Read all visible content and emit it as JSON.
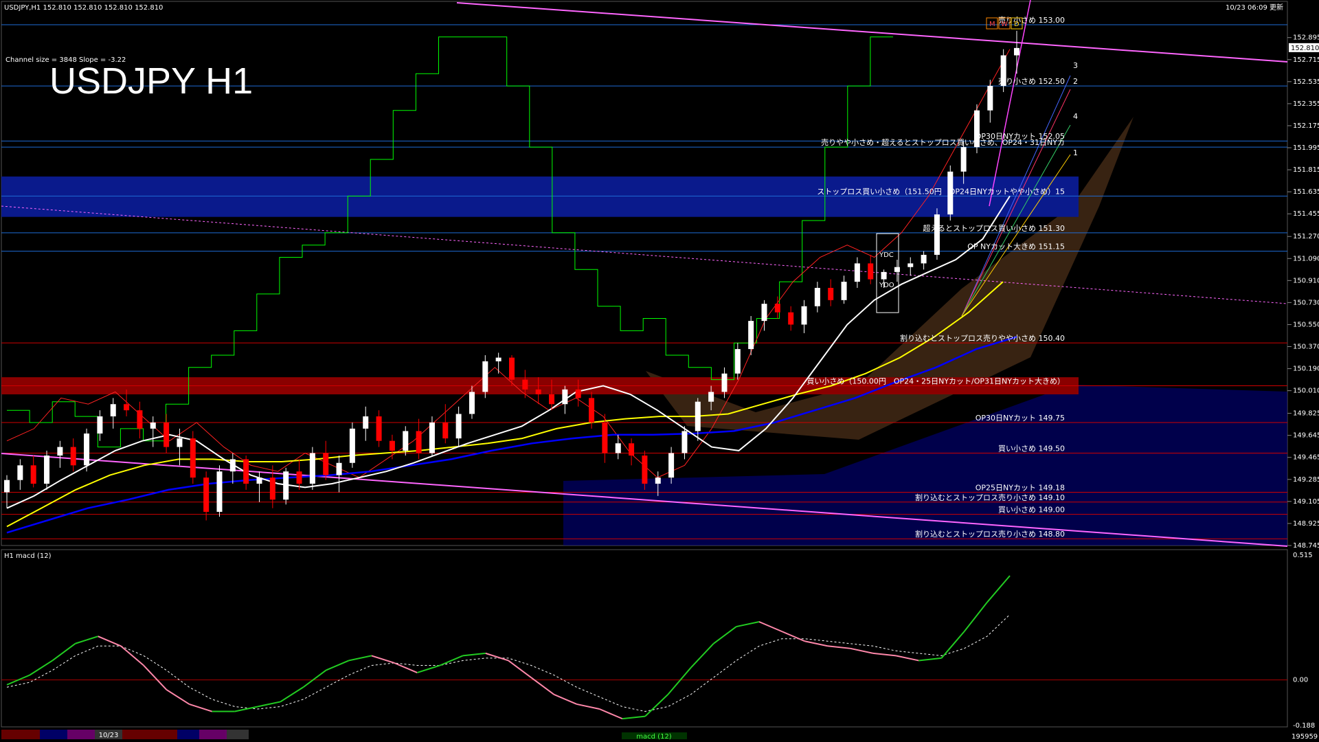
{
  "window": {
    "symbol_info": "USDJPY,H1  152.810 152.810 152.810 152.810",
    "timestamp": "10/23 06:09 更新",
    "title": "USDJPY H1",
    "channel_info": "Channel size = 3848 Slope = -3.22"
  },
  "colors": {
    "background": "#000000",
    "bull": "#ffffff",
    "bear": "#ff0000",
    "sma_white": "#ffffff",
    "sma_yellow": "#ffff00",
    "sma_blue": "#0000ff",
    "ichimoku_span": "#00ff00",
    "channel": "#ff66ff",
    "level_line": "#1e6bd6",
    "red_level": "#d00000",
    "macd_main": "#22cc22",
    "macd_down": "#ff88aa",
    "macd_signal": "#ffffff"
  },
  "chart_data": {
    "type": "candlestick",
    "symbol": "USDJPY",
    "timeframe": "H1",
    "ylim": [
      148.745,
      153.0
    ],
    "y_ticks": [
      "152.895",
      "152.715",
      "152.535",
      "152.355",
      "152.175",
      "151.995",
      "151.815",
      "151.635",
      "151.455",
      "151.270",
      "151.090",
      "150.910",
      "150.730",
      "150.550",
      "150.370",
      "150.190",
      "150.010",
      "149.825",
      "149.645",
      "149.465",
      "149.285",
      "149.105",
      "148.925",
      "148.745"
    ],
    "current_price": "152.810",
    "candles_ohlc": [
      [
        149.18,
        149.32,
        149.05,
        149.28
      ],
      [
        149.28,
        149.45,
        149.2,
        149.4
      ],
      [
        149.4,
        149.48,
        149.22,
        149.25
      ],
      [
        149.25,
        149.52,
        149.2,
        149.48
      ],
      [
        149.48,
        149.6,
        149.38,
        149.55
      ],
      [
        149.55,
        149.62,
        149.35,
        149.4
      ],
      [
        149.4,
        149.7,
        149.35,
        149.66
      ],
      [
        149.66,
        149.85,
        149.6,
        149.8
      ],
      [
        149.8,
        149.95,
        149.7,
        149.9
      ],
      [
        149.9,
        150.02,
        149.8,
        149.85
      ],
      [
        149.85,
        149.92,
        149.62,
        149.7
      ],
      [
        149.7,
        149.8,
        149.55,
        149.75
      ],
      [
        149.75,
        149.82,
        149.5,
        149.55
      ],
      [
        149.55,
        149.7,
        149.4,
        149.62
      ],
      [
        149.62,
        149.68,
        149.25,
        149.3
      ],
      [
        149.3,
        149.35,
        148.95,
        149.02
      ],
      [
        149.02,
        149.4,
        148.98,
        149.35
      ],
      [
        149.35,
        149.5,
        149.25,
        149.45
      ],
      [
        149.45,
        149.48,
        149.2,
        149.25
      ],
      [
        149.25,
        149.35,
        149.1,
        149.3
      ],
      [
        149.3,
        149.4,
        149.05,
        149.12
      ],
      [
        149.12,
        149.38,
        149.08,
        149.35
      ],
      [
        149.35,
        149.45,
        149.2,
        149.25
      ],
      [
        149.25,
        149.55,
        149.2,
        149.5
      ],
      [
        149.5,
        149.6,
        149.28,
        149.32
      ],
      [
        149.32,
        149.48,
        149.18,
        149.42
      ],
      [
        149.42,
        149.75,
        149.38,
        149.7
      ],
      [
        149.7,
        149.88,
        149.6,
        149.8
      ],
      [
        149.8,
        149.85,
        149.55,
        149.6
      ],
      [
        149.6,
        149.65,
        149.45,
        149.52
      ],
      [
        149.52,
        149.72,
        149.48,
        149.68
      ],
      [
        149.68,
        149.78,
        149.45,
        149.5
      ],
      [
        149.5,
        149.8,
        149.48,
        149.75
      ],
      [
        149.75,
        149.9,
        149.58,
        149.62
      ],
      [
        149.62,
        149.88,
        149.55,
        149.82
      ],
      [
        149.82,
        150.05,
        149.78,
        150.0
      ],
      [
        150.0,
        150.3,
        149.95,
        150.25
      ],
      [
        150.25,
        150.32,
        150.15,
        150.28
      ],
      [
        150.28,
        150.3,
        150.05,
        150.1
      ],
      [
        150.1,
        150.18,
        149.95,
        150.02
      ],
      [
        150.02,
        150.12,
        149.9,
        149.98
      ],
      [
        149.98,
        150.1,
        149.85,
        149.9
      ],
      [
        149.9,
        150.05,
        149.82,
        150.02
      ],
      [
        150.02,
        150.1,
        149.88,
        149.95
      ],
      [
        149.95,
        150.0,
        149.7,
        149.75
      ],
      [
        149.75,
        149.82,
        149.42,
        149.5
      ],
      [
        149.5,
        149.65,
        149.45,
        149.58
      ],
      [
        149.58,
        149.62,
        149.4,
        149.48
      ],
      [
        149.48,
        149.52,
        149.2,
        149.25
      ],
      [
        149.25,
        149.35,
        149.15,
        149.3
      ],
      [
        149.3,
        149.55,
        149.25,
        149.5
      ],
      [
        149.5,
        149.72,
        149.45,
        149.68
      ],
      [
        149.68,
        149.95,
        149.6,
        149.92
      ],
      [
        149.92,
        150.05,
        149.85,
        150.0
      ],
      [
        150.0,
        150.2,
        149.95,
        150.15
      ],
      [
        150.15,
        150.4,
        150.1,
        150.35
      ],
      [
        150.35,
        150.62,
        150.3,
        150.58
      ],
      [
        150.58,
        150.75,
        150.5,
        150.72
      ],
      [
        150.72,
        150.78,
        150.6,
        150.65
      ],
      [
        150.65,
        150.7,
        150.5,
        150.55
      ],
      [
        150.55,
        150.75,
        150.48,
        150.7
      ],
      [
        150.7,
        150.9,
        150.65,
        150.85
      ],
      [
        150.85,
        150.92,
        150.7,
        150.75
      ],
      [
        150.75,
        150.95,
        150.72,
        150.9
      ],
      [
        150.9,
        151.1,
        150.85,
        151.05
      ],
      [
        151.05,
        151.12,
        150.88,
        150.92
      ],
      [
        150.92,
        151.0,
        150.85,
        150.98
      ],
      [
        150.98,
        151.08,
        150.9,
        151.02
      ],
      [
        151.02,
        151.1,
        150.95,
        151.05
      ],
      [
        151.05,
        151.15,
        151.0,
        151.12
      ],
      [
        151.12,
        151.5,
        151.08,
        151.45
      ],
      [
        151.45,
        151.85,
        151.4,
        151.8
      ],
      [
        151.8,
        152.05,
        151.7,
        152.0
      ],
      [
        152.0,
        152.35,
        151.95,
        152.3
      ],
      [
        152.3,
        152.55,
        152.2,
        152.5
      ],
      [
        152.5,
        152.8,
        152.45,
        152.75
      ],
      [
        152.75,
        152.95,
        152.6,
        152.81
      ]
    ],
    "sma_white": [
      149.05,
      149.15,
      149.28,
      149.4,
      149.52,
      149.6,
      149.65,
      149.6,
      149.45,
      149.32,
      149.25,
      149.22,
      149.25,
      149.3,
      149.35,
      149.42,
      149.5,
      149.58,
      149.65,
      149.72,
      149.85,
      150.0,
      150.05,
      149.98,
      149.85,
      149.7,
      149.55,
      149.52,
      149.7,
      149.95,
      150.25,
      150.55,
      150.75,
      150.88,
      150.98,
      151.08,
      151.25,
      151.6
    ],
    "sma_yellow": [
      148.9,
      149.05,
      149.2,
      149.32,
      149.4,
      149.45,
      149.45,
      149.43,
      149.43,
      149.45,
      149.48,
      149.5,
      149.52,
      149.55,
      149.58,
      149.62,
      149.7,
      149.75,
      149.78,
      149.8,
      149.8,
      149.82,
      149.9,
      149.98,
      150.05,
      150.15,
      150.28,
      150.45,
      150.65,
      150.9
    ],
    "sma_blue": [
      148.85,
      148.95,
      149.05,
      149.12,
      149.2,
      149.25,
      149.28,
      149.3,
      149.32,
      149.35,
      149.4,
      149.45,
      149.52,
      149.58,
      149.62,
      149.65,
      149.65,
      149.66,
      149.68,
      149.75,
      149.85,
      149.95,
      150.08,
      150.2,
      150.35,
      150.45
    ],
    "ichimoku_chikou": [
      149.6,
      149.7,
      149.95,
      149.9,
      150.0,
      149.8,
      149.6,
      149.75,
      149.55,
      149.4,
      149.35,
      149.5,
      149.4,
      149.3,
      149.45,
      149.6,
      149.8,
      150.0,
      150.2,
      150.0,
      149.85,
      149.95,
      149.8,
      149.5,
      149.3,
      149.4,
      149.7,
      150.1,
      150.6,
      150.9,
      151.1,
      151.2,
      151.1,
      151.3,
      151.6,
      152.0,
      152.4,
      152.8
    ],
    "ichimoku_green_line": [
      149.85,
      149.75,
      149.92,
      149.8,
      149.55,
      149.7,
      149.6,
      149.9,
      150.2,
      150.3,
      150.5,
      150.8,
      151.1,
      151.2,
      151.3,
      151.6,
      151.9,
      152.3,
      152.6,
      152.9,
      152.9,
      152.9,
      152.5,
      152.0,
      151.3,
      151.0,
      150.7,
      150.5,
      150.6,
      150.3,
      150.2,
      150.1,
      150.4,
      150.6,
      150.9,
      151.4,
      152.0,
      152.5,
      152.9,
      152.9
    ],
    "level_labels": [
      {
        "text": "売り小さめ 153.00",
        "price": 153.0
      },
      {
        "text": "売り小さめ 152.50",
        "price": 152.5
      },
      {
        "text": "OP30日NYカット 152.05",
        "price": 152.05
      },
      {
        "text": "売りやや小さめ・超えるとストップロス買い小さめ、OP24・31日NYカ",
        "price": 152.0
      },
      {
        "text": "ストップロス買い小さめ（151.50円　OP24日NYカットやや小さめ）15",
        "price": 151.6
      },
      {
        "text": "超えるとストップロス買い小さめ 151.30",
        "price": 151.3
      },
      {
        "text": "OP NYカット大きめ 151.15",
        "price": 151.15
      },
      {
        "text": "割り込むとストップロス売りやや小さめ 150.40",
        "price": 150.4
      },
      {
        "text": "買い小さめ（150.00円　OP24・25日NYカット/OP31日NYカット大きめ）",
        "price": 150.05
      },
      {
        "text": "OP30日NYカット 149.75",
        "price": 149.75
      },
      {
        "text": "買い小さめ 149.50",
        "price": 149.5
      },
      {
        "text": "OP25日NYカット 149.18",
        "price": 149.18
      },
      {
        "text": "割り込むとストップロス売り小さめ 149.10",
        "price": 149.1
      },
      {
        "text": "買い小さめ 149.00",
        "price": 149.0
      },
      {
        "text": "割り込むとストップロス売り小さめ 148.80",
        "price": 148.8
      }
    ],
    "fan_labels": [
      "3",
      "2",
      "4",
      "1"
    ],
    "box_labels": [
      "YDC",
      "YDO",
      "M",
      "W",
      "D"
    ],
    "macd": {
      "title": "H1  macd (12)",
      "y_ticks": [
        "0.515",
        "0.00",
        "-0.188"
      ],
      "main": [
        -0.02,
        0.02,
        0.08,
        0.15,
        0.18,
        0.14,
        0.06,
        -0.04,
        -0.1,
        -0.13,
        -0.13,
        -0.11,
        -0.09,
        -0.03,
        0.04,
        0.08,
        0.1,
        0.07,
        0.03,
        0.06,
        0.1,
        0.11,
        0.08,
        0.01,
        -0.06,
        -0.1,
        -0.12,
        -0.16,
        -0.15,
        -0.06,
        0.05,
        0.15,
        0.22,
        0.24,
        0.2,
        0.16,
        0.14,
        0.13,
        0.11,
        0.1,
        0.08,
        0.09,
        0.2,
        0.32,
        0.43
      ],
      "signal": [
        -0.03,
        -0.01,
        0.04,
        0.1,
        0.14,
        0.14,
        0.1,
        0.04,
        -0.03,
        -0.08,
        -0.11,
        -0.12,
        -0.11,
        -0.08,
        -0.03,
        0.02,
        0.06,
        0.07,
        0.06,
        0.06,
        0.08,
        0.09,
        0.09,
        0.06,
        0.02,
        -0.03,
        -0.07,
        -0.11,
        -0.13,
        -0.11,
        -0.06,
        0.01,
        0.08,
        0.14,
        0.17,
        0.17,
        0.16,
        0.15,
        0.14,
        0.12,
        0.11,
        0.1,
        0.13,
        0.18,
        0.27
      ]
    }
  },
  "bottom_bar": {
    "tab_date": "10/23",
    "indicator_tab": "macd (12)",
    "bars_count": "195959"
  }
}
